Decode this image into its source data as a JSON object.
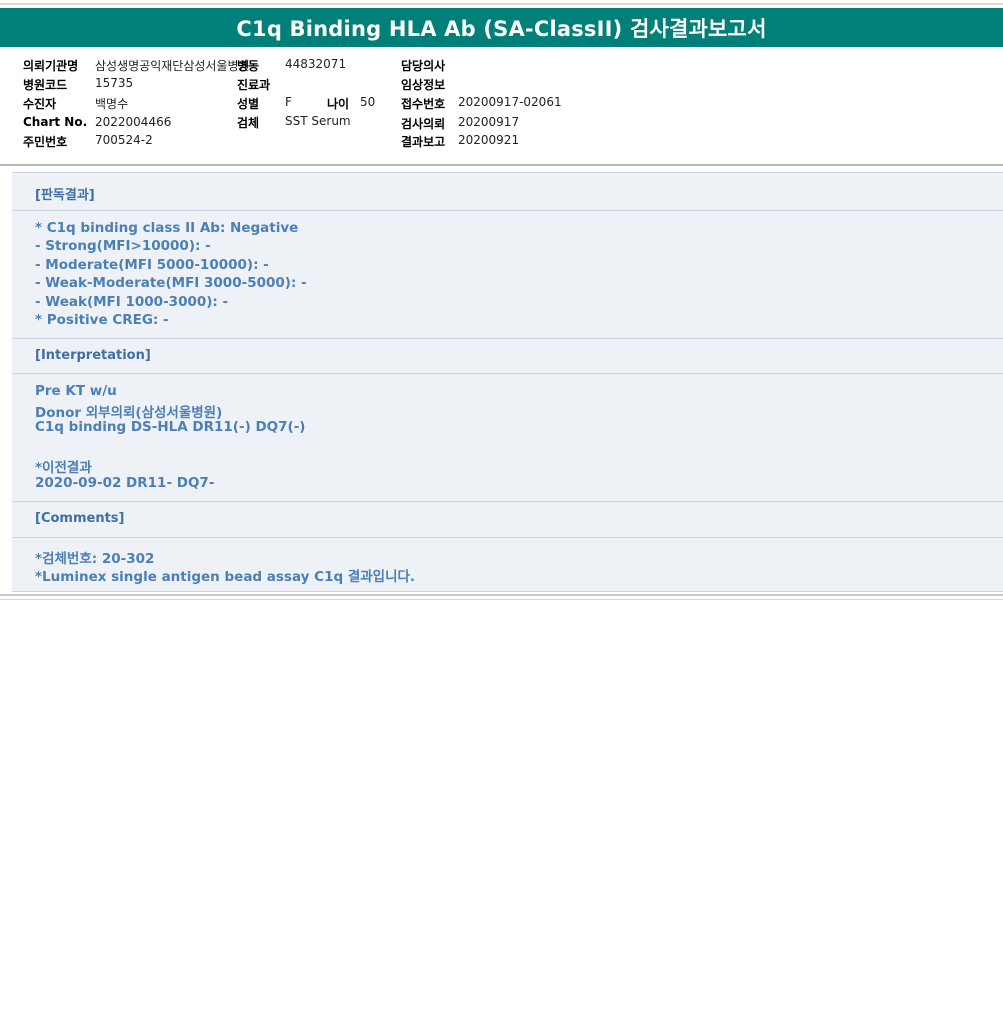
{
  "report": {
    "title": "C1q Binding HLA Ab (SA-ClassII) 검사결과보고서"
  },
  "header": {
    "institution_label": "의뢰기관명",
    "institution_value": "삼성생명공익재단삼성서울병원",
    "ward_label": "병동",
    "ward_value": "44832071",
    "doctor_label": "담당의사",
    "doctor_value": "",
    "hospital_code_label": "병원코드",
    "hospital_code_value": "15735",
    "department_label": "진료과",
    "department_value": "",
    "clinical_info_label": "임상정보",
    "clinical_info_value": "",
    "patient_label": "수진자",
    "patient_value": "백명수",
    "sex_label": "성별",
    "sex_value": "F",
    "age_label": "나이",
    "age_value": "50",
    "receipt_no_label": "접수번호",
    "receipt_no_value": "20200917-02061",
    "chart_no_label": "Chart No.",
    "chart_no_value": "2022004466",
    "specimen_label": "검체",
    "specimen_value": "SST Serum",
    "request_date_label": "검사의뢰",
    "request_date_value": "20200917",
    "resident_no_label": "주민번호",
    "resident_no_value": "700524-2",
    "report_date_label": "결과보고",
    "report_date_value": "20200921"
  },
  "sections": {
    "result": {
      "heading": "[판독결과]",
      "lines": [
        "* C1q binding class II Ab: Negative",
        "- Strong(MFI>10000): -",
        "- Moderate(MFI 5000-10000): -",
        "- Weak-Moderate(MFI 3000-5000): -",
        "- Weak(MFI 1000-3000): -",
        "* Positive CREG: -"
      ]
    },
    "interpretation": {
      "heading": "[Interpretation]",
      "lines": [
        "Pre KT w/u",
        "Donor 외부의뢰(삼성서울병원)",
        "C1q binding DS-HLA DR11(-) DQ7(-)",
        "",
        "*이전결과",
        "2020-09-02 DR11- DQ7-"
      ]
    },
    "comments": {
      "heading": "[Comments]",
      "lines": [
        "*검체번호: 20-302",
        "*Luminex single antigen bead assay C1q 결과입니다."
      ]
    }
  }
}
